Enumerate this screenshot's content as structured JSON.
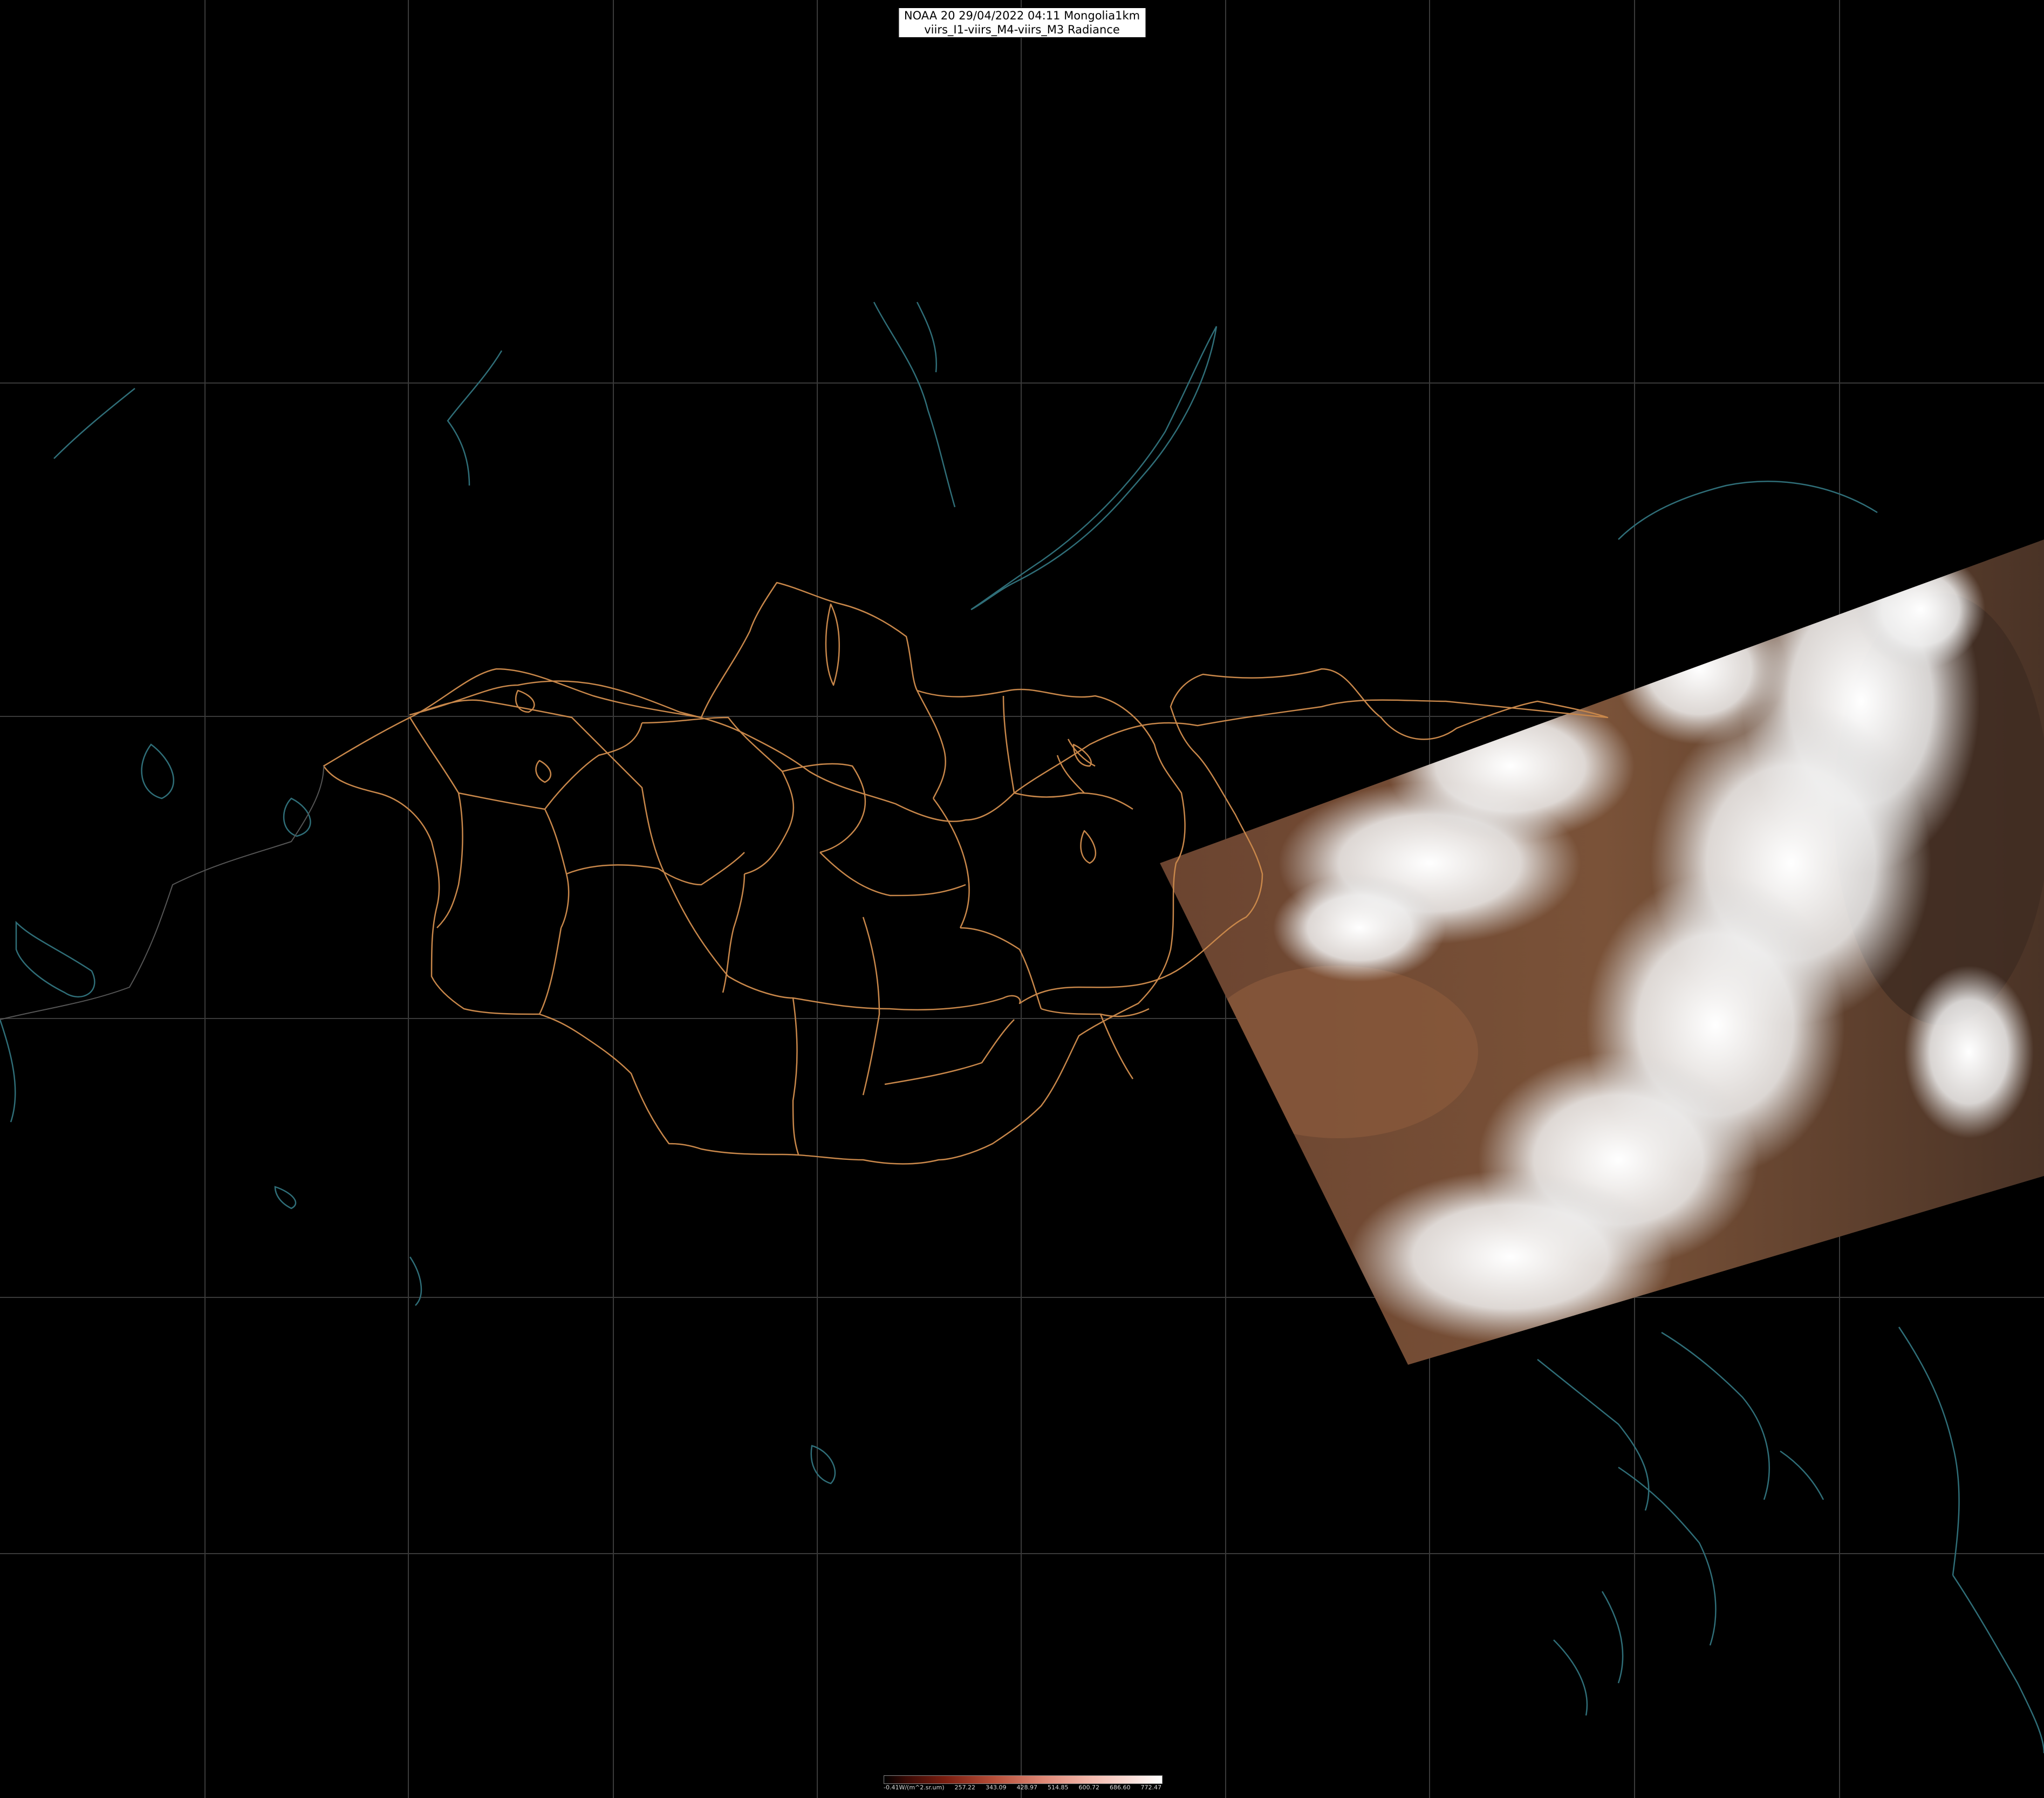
{
  "header": {
    "line1": "NOAA 20 29/04/2022 04:11 Mongolia1km",
    "line2": "viirs_I1-viirs_M4-viirs_M3 Radiance"
  },
  "colorbar": {
    "labels": [
      "-0.41W/(m^2.sr.um)",
      "257.22",
      "343.09",
      "428.97",
      "514.85",
      "600.72",
      "686.60",
      "772.47"
    ]
  },
  "colors": {
    "background": "#000000",
    "border": "#c8874a",
    "coastline": "#2f6e78",
    "grid": "#3a3a3a"
  }
}
